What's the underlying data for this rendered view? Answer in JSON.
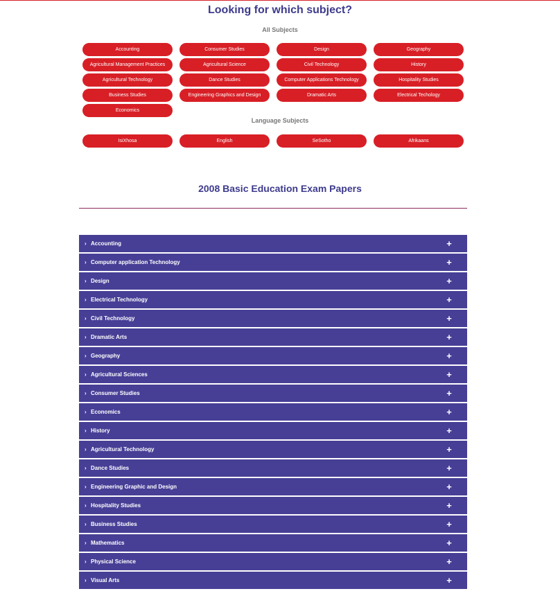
{
  "heading": "Looking for which subject?",
  "all_subjects": {
    "label": "All Subjects",
    "items": [
      "Accounting",
      "Consumer Studies",
      "Design",
      "Geography",
      "Agricultural Management Practices",
      "Agricultural Science",
      "Civil Technology",
      "History",
      "Agricultural Technology",
      "Dance Studies",
      "Computer Applications Technology",
      "Hospitality Studies",
      "Business Studies",
      "Engineering Graphics and Design",
      "Dramatic Arts",
      "Electrical Techology",
      "Economics"
    ]
  },
  "language_subjects": {
    "label": "Language Subjects",
    "items": [
      "IsiXhosa",
      "English",
      "SeSotho",
      "Afrikaans"
    ]
  },
  "section_title": "2008 Basic Education Exam Papers",
  "accordion": {
    "chevron_glyph": "›",
    "expand_glyph": "+",
    "items": [
      "Accounting",
      "Computer application Technology",
      "Design",
      "Electrical Technology",
      "Civil Technology",
      "Dramatic Arts",
      "Geography",
      "Agricultural Sciences",
      "Consumer Studies",
      "Economics",
      "History",
      "Agricultural Technology",
      "Dance Studies",
      "Engineering Graphic and Design",
      "Hospitality Studies",
      "Business Studies",
      "Mathematics",
      "Physical Science",
      "Visual Arts"
    ]
  },
  "colors": {
    "pill": "#d81f26",
    "accordion": "#473f96",
    "heading": "#3d3a8c"
  }
}
